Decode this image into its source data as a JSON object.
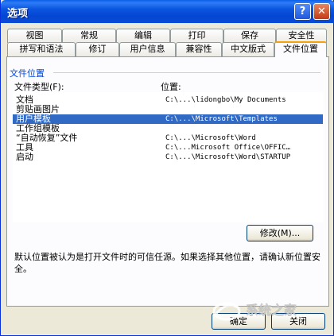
{
  "window": {
    "title": "选项"
  },
  "titlebar": {
    "help_glyph": "?",
    "close_glyph": "✕"
  },
  "tabs": {
    "row1": [
      "视图",
      "常规",
      "编辑",
      "打印",
      "保存",
      "安全性"
    ],
    "row2": [
      "拼写和语法",
      "修订",
      "用户信息",
      "兼容性",
      "中文版式",
      "文件位置"
    ],
    "active": "文件位置"
  },
  "file_locations": {
    "group_label": "文件位置",
    "col_type_label": "文件类型(F):",
    "col_location_label": "位置:",
    "rows": [
      {
        "type": "文档",
        "location": "C:\\...\\lidongbo\\My Documents"
      },
      {
        "type": "剪贴画图片",
        "location": ""
      },
      {
        "type": "用户模板",
        "location": "C:\\...\\Microsoft\\Templates",
        "selected": true
      },
      {
        "type": "工作组模板",
        "location": ""
      },
      {
        "type": "“自动恢复”文件",
        "location": "C:\\...\\Microsoft\\Word"
      },
      {
        "type": "工具",
        "location": "C:\\...Microsoft Office\\OFFIC…"
      },
      {
        "type": "启动",
        "location": "C:\\...\\Microsoft\\Word\\STARTUP"
      }
    ],
    "modify_button": "修改(M)...",
    "note": "默认位置被认为是打开文件时的可信任源。如果选择其他位置，请确认新位置安全。"
  },
  "footer": {
    "ok_label": "确定",
    "close_label": "关闭"
  },
  "watermark": {
    "text": "系统之家"
  }
}
